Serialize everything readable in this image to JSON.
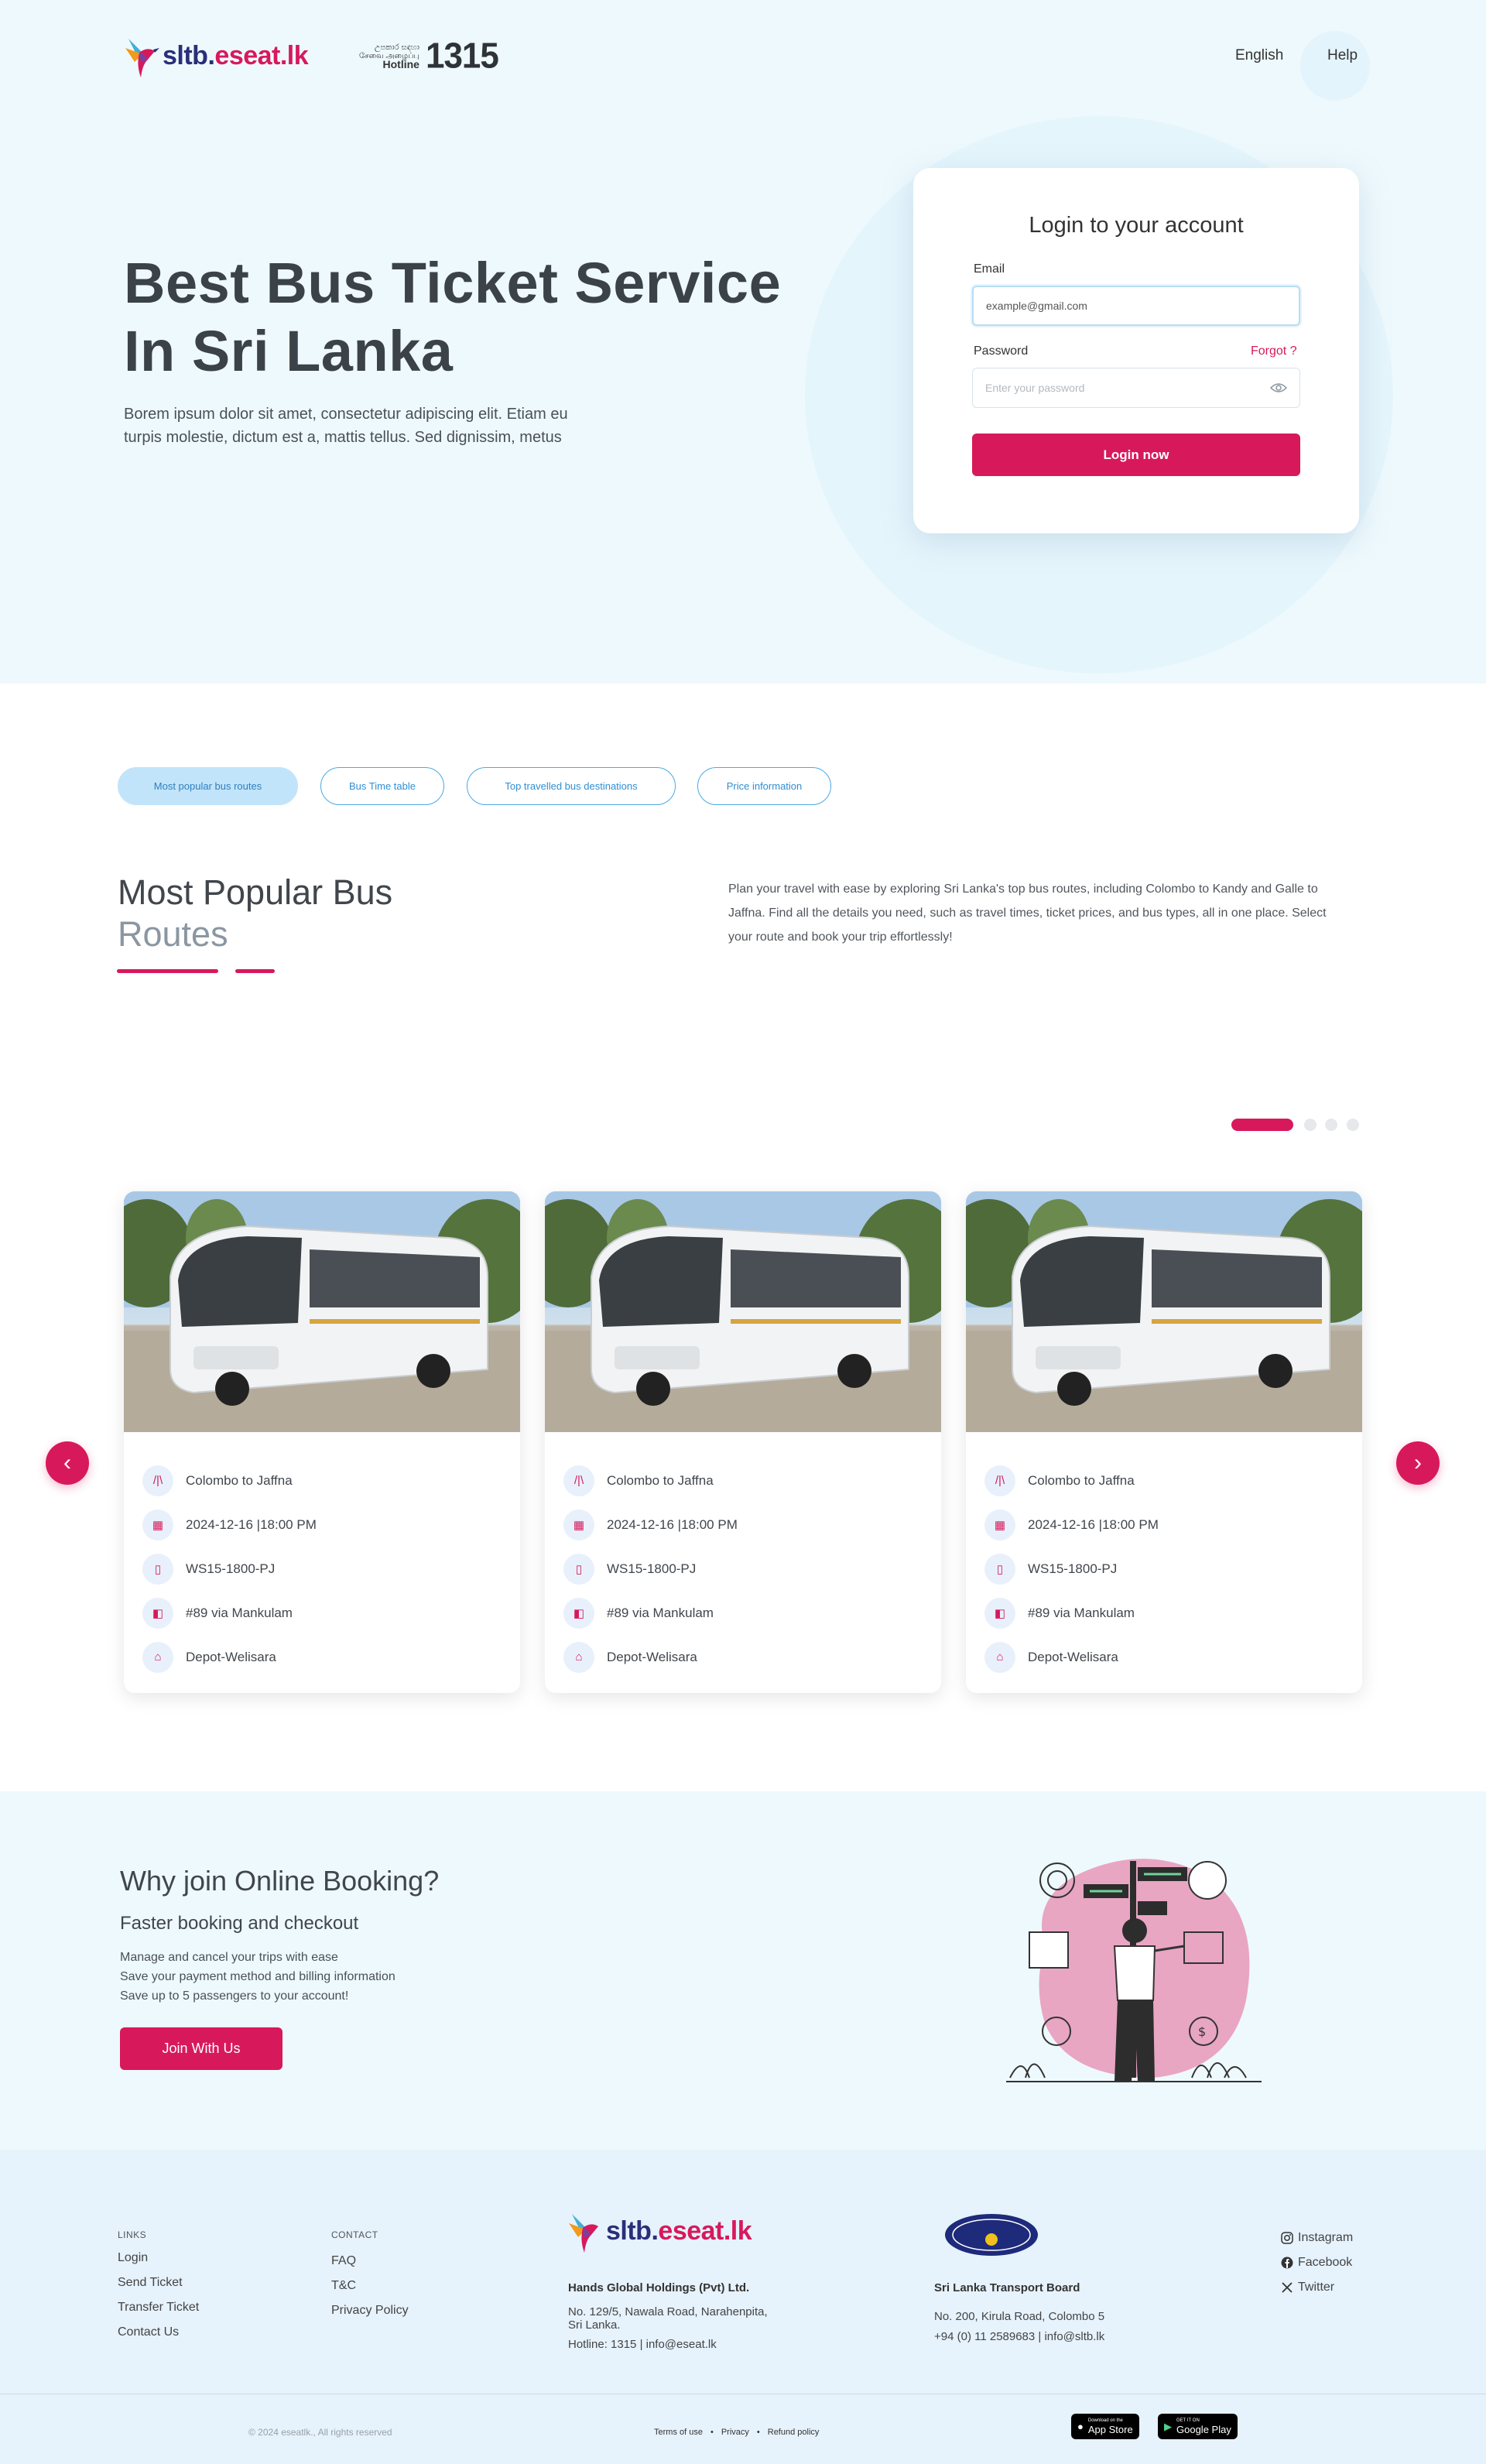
{
  "header": {
    "logo_text_a": "sltb.",
    "logo_text_b": "eseat.lk",
    "hotline_line1": "උපකාර සඳහා",
    "hotline_line2": "சேவை அழைப்பு",
    "hotline_label": "Hotline",
    "hotline_number": "1315",
    "nav": [
      "English",
      "Help"
    ]
  },
  "hero": {
    "title_line1": "Best Bus Ticket Service",
    "title_line2": "In Sri Lanka",
    "subtitle_line1": "Borem ipsum dolor sit amet, consectetur adipiscing elit. Etiam eu",
    "subtitle_line2": "turpis molestie, dictum est a, mattis tellus. Sed dignissim, metus"
  },
  "login": {
    "title": "Login to your account",
    "email_label": "Email",
    "email_value": "example@gmail.com",
    "password_label": "Password",
    "forgot": "Forgot ?",
    "password_placeholder": "Enter your password",
    "submit": "Login now"
  },
  "tabs": [
    "Most popular bus routes",
    "Bus Time table",
    "Top travelled bus destinations",
    "Price information"
  ],
  "popular": {
    "title_line1": "Most Popular Bus",
    "title_line2": "Routes",
    "description_line1": "Plan your travel with ease by exploring Sri Lanka's top bus routes, including Colombo to Kandy and Galle to",
    "description_line2": "Jaffna. Find all the details you need, such as travel times, ticket prices, and bus types, all in one place. Select",
    "description_line3": "your route and book your trip effortlessly!"
  },
  "carousel": {
    "active_page": 1,
    "page_count": 4,
    "cards": [
      {
        "route": "Colombo to Jaffna",
        "datetime": "2024-12-16 |18:00 PM",
        "bus_no": "WS15-1800-PJ",
        "route_no": "#89 via Mankulam",
        "depot": "Depot-Welisara"
      },
      {
        "route": "Colombo to Jaffna",
        "datetime": "2024-12-16 |18:00 PM",
        "bus_no": "WS15-1800-PJ",
        "route_no": "#89 via Mankulam",
        "depot": "Depot-Welisara"
      },
      {
        "route": "Colombo to Jaffna",
        "datetime": "2024-12-16 |18:00 PM",
        "bus_no": "WS15-1800-PJ",
        "route_no": "#89 via Mankulam",
        "depot": "Depot-Welisara"
      }
    ]
  },
  "why": {
    "title": "Why join Online Booking?",
    "subtitle": "Faster booking and checkout",
    "points": [
      "Manage and cancel your trips with ease",
      "Save your payment method and billing information",
      "Save up to 5 passengers to your account!"
    ],
    "button": "Join With Us"
  },
  "footer": {
    "links_head": "LINKS",
    "links": [
      "Login",
      "Send Ticket",
      "Transfer Ticket",
      "Contact Us"
    ],
    "contact_head": "CONTACT",
    "contact": [
      "FAQ",
      "T&C",
      "Privacy Policy"
    ],
    "company_name": "Hands Global Holdings (Pvt) Ltd.",
    "company_addr1": "No. 129/5, Nawala Road, Narahenpita,",
    "company_addr2": "Sri Lanka.",
    "company_contact": "Hotline: 1315 | info@eseat.lk",
    "board_name": "Sri Lanka Transport Board",
    "board_addr": "No. 200, Kirula Road, Colombo 5",
    "board_contact": "+94 (0) 11 2589683 | info@sltb.lk",
    "social": [
      "Instagram",
      "Facebook",
      "Twitter"
    ],
    "copyright": "© 2024 eseatlk., All rights reserved",
    "legal": [
      "Terms of use",
      "Privacy",
      "Refund policy"
    ],
    "appstore_small": "Download on the",
    "appstore": "App Store",
    "googleplay_small": "GET IT ON",
    "googleplay": "Google Play"
  },
  "colors": {
    "accent": "#d7195c",
    "hero_bg": "#eef9fd",
    "tab_blue": "#4ca9e4",
    "footer_bg": "#e6f2fc"
  }
}
